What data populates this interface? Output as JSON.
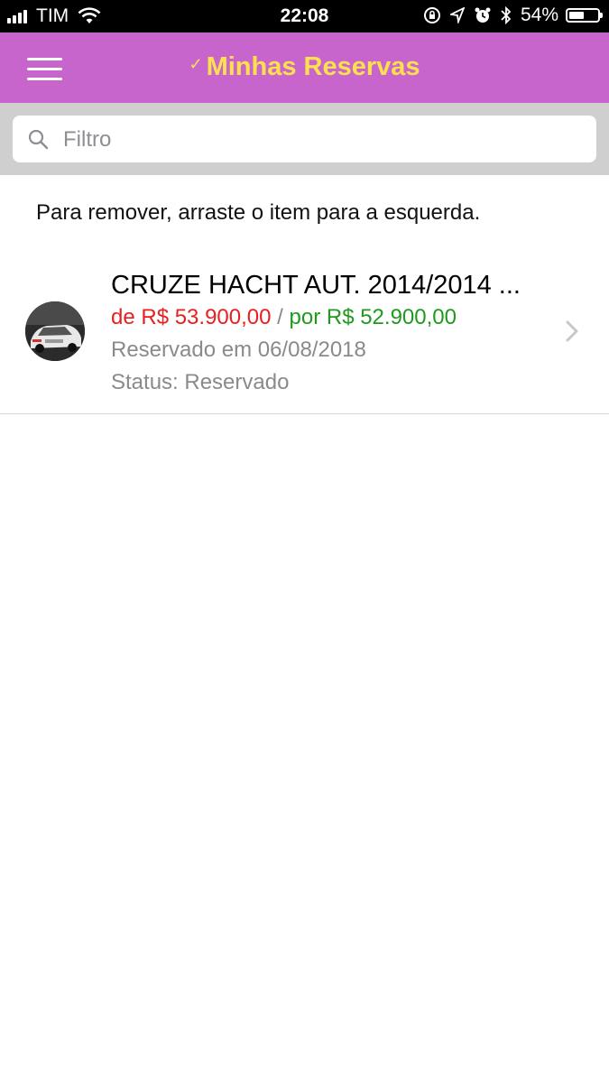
{
  "status_bar": {
    "carrier": "TIM",
    "time": "22:08",
    "battery_percent_label": "54%",
    "battery_level": 0.54,
    "icons": [
      "signal-icon",
      "wifi-icon",
      "orientation-lock-icon",
      "location-icon",
      "alarm-icon",
      "bluetooth-icon",
      "battery-icon"
    ]
  },
  "header": {
    "title": "Minhas Reservas",
    "check_glyph": "✓",
    "colors": {
      "background": "#c765cc",
      "title": "#ffe04d"
    }
  },
  "search": {
    "placeholder": "Filtro",
    "value": ""
  },
  "hint": "Para remover, arraste o item para a esquerda.",
  "reservations": [
    {
      "title": "CRUZE HACHT AUT. 2014/2014 ...",
      "price_old": "de R$ 53.900,00",
      "price_separator": " / ",
      "price_new": "por R$ 52.900,00",
      "reserved_on": "Reservado em 06/08/2018",
      "status": "Status: Reservado",
      "colors": {
        "price_old": "#e82020",
        "price_new": "#1f9a1f",
        "meta": "#8a8a8a"
      }
    }
  ]
}
